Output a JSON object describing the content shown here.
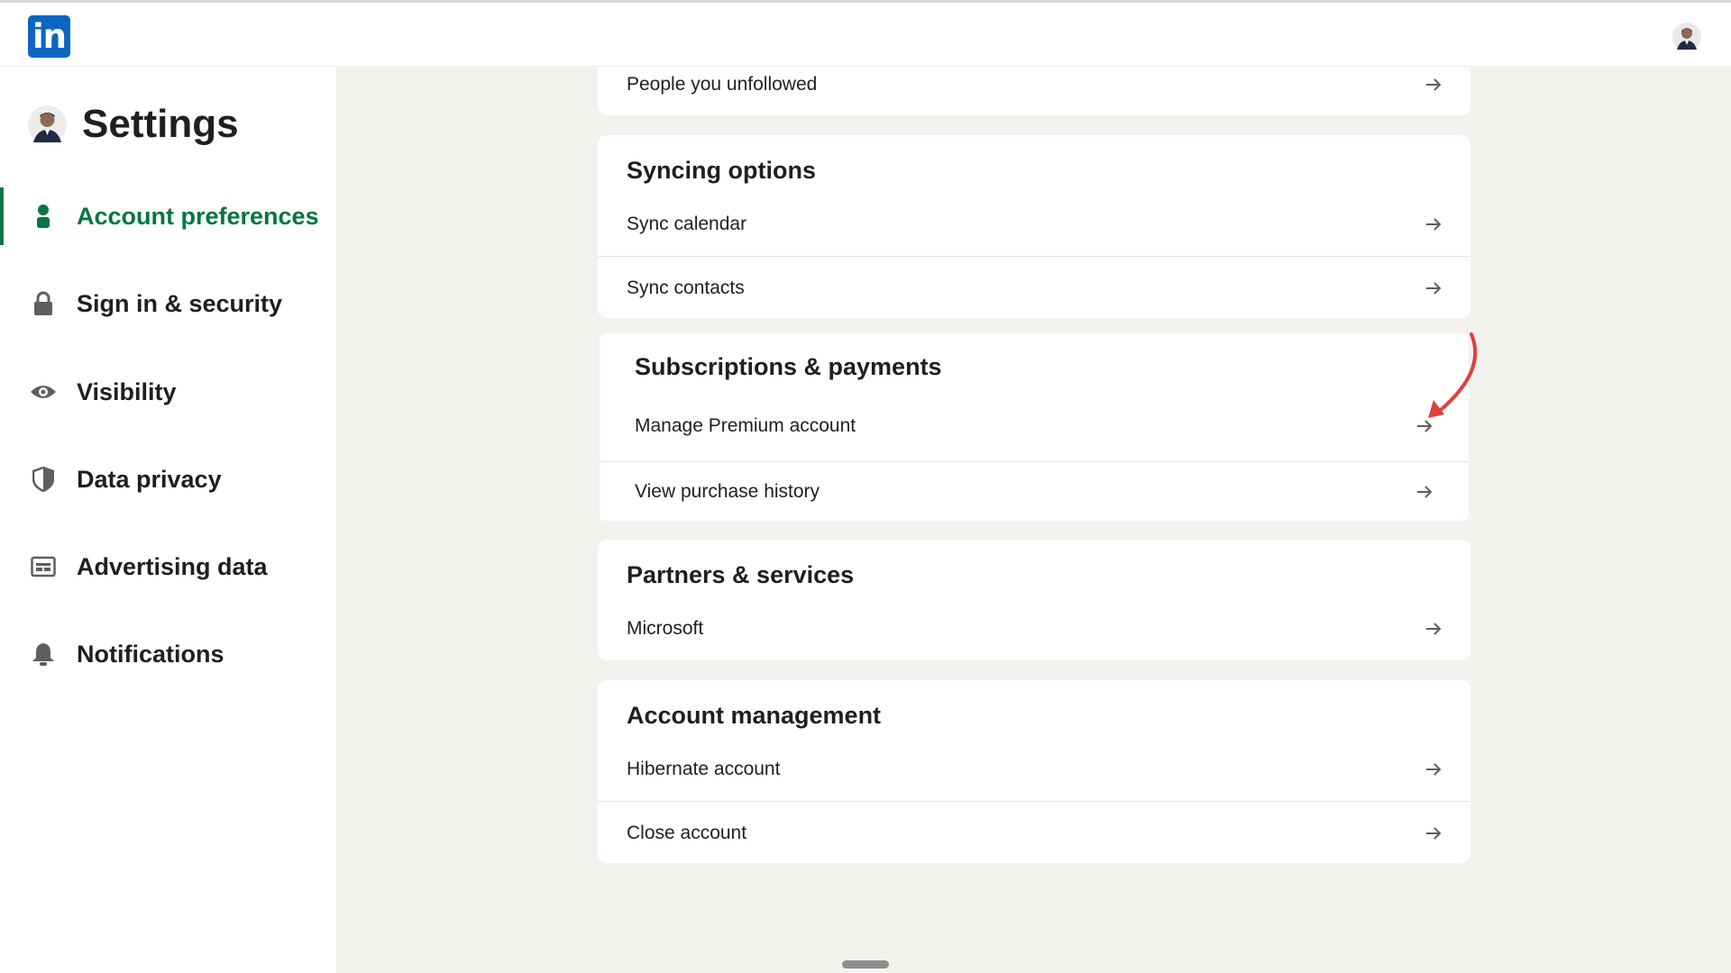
{
  "header": {
    "logo_text": "in",
    "brand_color": "#0a66c2"
  },
  "sidebar": {
    "title": "Settings",
    "active_color": "#057642",
    "items": [
      {
        "label": "Account preferences",
        "icon": "person-icon",
        "active": true
      },
      {
        "label": "Sign in & security",
        "icon": "lock-icon",
        "active": false
      },
      {
        "label": "Visibility",
        "icon": "eye-icon",
        "active": false
      },
      {
        "label": "Data privacy",
        "icon": "shield-icon",
        "active": false
      },
      {
        "label": "Advertising data",
        "icon": "ad-icon",
        "active": false
      },
      {
        "label": "Notifications",
        "icon": "bell-icon",
        "active": false
      }
    ]
  },
  "main": {
    "partial_card": {
      "rows": [
        "People you unfollowed"
      ]
    },
    "syncing": {
      "title": "Syncing options",
      "rows": [
        "Sync calendar",
        "Sync contacts"
      ]
    },
    "subscriptions": {
      "title": "Subscriptions & payments",
      "rows": [
        "Manage Premium account",
        "View purchase history"
      ]
    },
    "partners": {
      "title": "Partners & services",
      "rows": [
        "Microsoft"
      ]
    },
    "account_management": {
      "title": "Account management",
      "rows": [
        "Hibernate account",
        "Close account"
      ]
    }
  },
  "annotation": {
    "color": "#e0403a"
  }
}
